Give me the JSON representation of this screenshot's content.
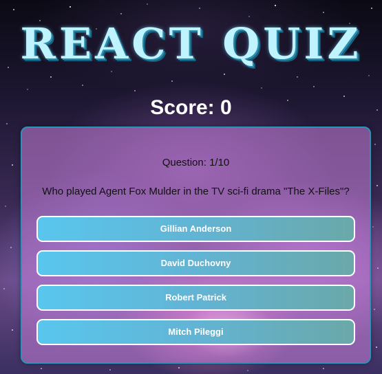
{
  "app": {
    "title": "REACT QUIZ",
    "score_text": "Score: 0"
  },
  "quiz": {
    "question_number": "Question: 1/10",
    "question_text": "Who played Agent Fox Mulder in the TV sci-fi drama \"The X-Files\"?",
    "answers": [
      {
        "label": "Gillian Anderson"
      },
      {
        "label": "David Duchovny"
      },
      {
        "label": "Robert Patrick"
      },
      {
        "label": "Mitch Pileggi"
      }
    ]
  },
  "colors": {
    "title": "#bff4ff",
    "title_shadow": "#1a5f7a",
    "card_border": "#2a93b8",
    "card_fill": "#c882dc",
    "answer_gradient_start": "#59c6ee",
    "answer_gradient_end": "#6aa8a9",
    "answer_border": "#ffffff"
  }
}
